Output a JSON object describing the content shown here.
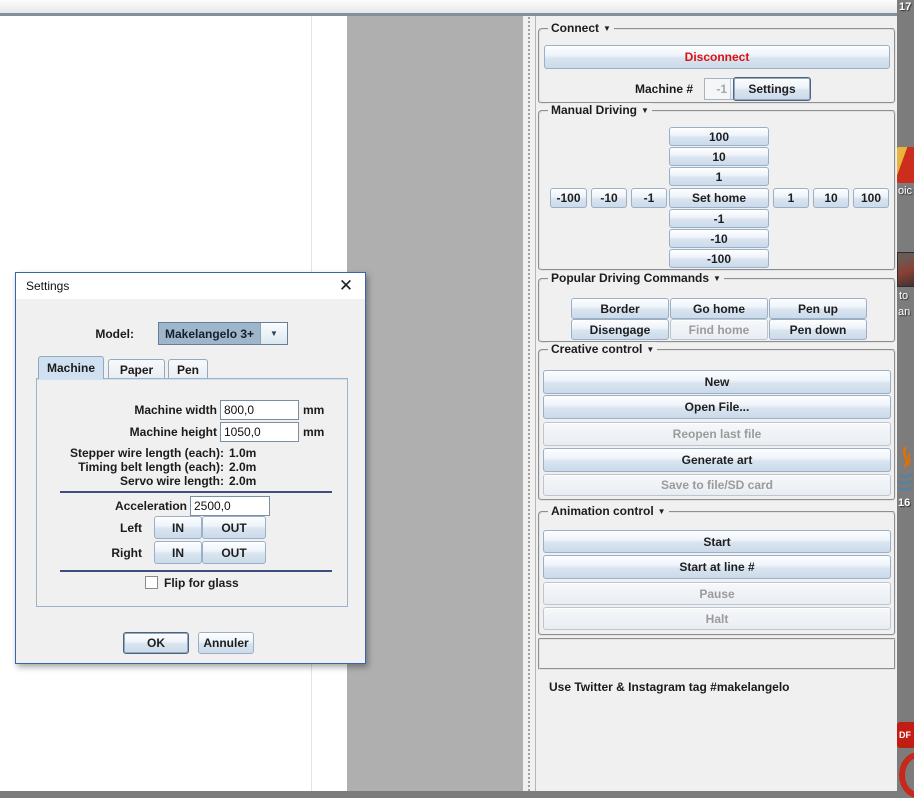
{
  "right_panel": {
    "connect": {
      "title": "Connect",
      "disconnect_label": "Disconnect",
      "machine_number_label": "Machine #",
      "machine_number_value": "-1",
      "settings_label": "Settings"
    },
    "manual_driving": {
      "title": "Manual Driving",
      "y_plus": [
        "100",
        "10",
        "1"
      ],
      "x_row": [
        "-100",
        "-10",
        "-1",
        "Set home",
        "1",
        "10",
        "100"
      ],
      "y_minus": [
        "-1",
        "-10",
        "-100"
      ]
    },
    "popular_commands": {
      "title": "Popular Driving Commands",
      "row1": [
        "Border",
        "Go home",
        "Pen up"
      ],
      "row2": [
        "Disengage",
        "Find home",
        "Pen down"
      ]
    },
    "creative_control": {
      "title": "Creative control",
      "new_label": "New",
      "open_file_label": "Open File...",
      "reopen_label": "Reopen last file",
      "generate_label": "Generate art",
      "save_label": "Save to file/SD card"
    },
    "animation_control": {
      "title": "Animation control",
      "start_label": "Start",
      "start_at_line_label": "Start at line #",
      "pause_label": "Pause",
      "halt_label": "Halt"
    },
    "footer_tag": "Use Twitter & Instagram tag #makelangelo"
  },
  "settings_dialog": {
    "title": "Settings",
    "model_label": "Model:",
    "model_value": "Makelangelo 3+",
    "tabs": [
      "Machine",
      "Paper",
      "Pen"
    ],
    "machine_tab": {
      "machine_width_label": "Machine width",
      "machine_width_value": "800,0",
      "machine_width_unit": "mm",
      "machine_height_label": "Machine height",
      "machine_height_value": "1050,0",
      "machine_height_unit": "mm",
      "wire_info": [
        {
          "label": "Stepper wire length (each):",
          "value": "1.0m"
        },
        {
          "label": "Timing belt length (each):",
          "value": "2.0m"
        },
        {
          "label": "Servo wire length:",
          "value": "2.0m"
        }
      ],
      "acceleration_label": "Acceleration",
      "acceleration_value": "2500,0",
      "left_label": "Left",
      "right_label": "Right",
      "in_label": "IN",
      "out_label": "OUT",
      "flip_for_glass_label": "Flip for glass"
    },
    "ok_label": "OK",
    "cancel_label": "Annuler"
  },
  "desktop": {
    "fragment_17": "17",
    "pdf_icon_label": "oic",
    "photo_label_line1": "to",
    "photo_label_line2": "an",
    "java_icon_label": "16",
    "pdf_bottom_text": "DF"
  },
  "colors": {
    "disconnect_red": "#dd1111",
    "separator_blue": "#3d4e7c",
    "panel_bg": "#f0f0f0",
    "canvas_gray": "#b0afaf",
    "dialog_border": "#3665b0"
  }
}
